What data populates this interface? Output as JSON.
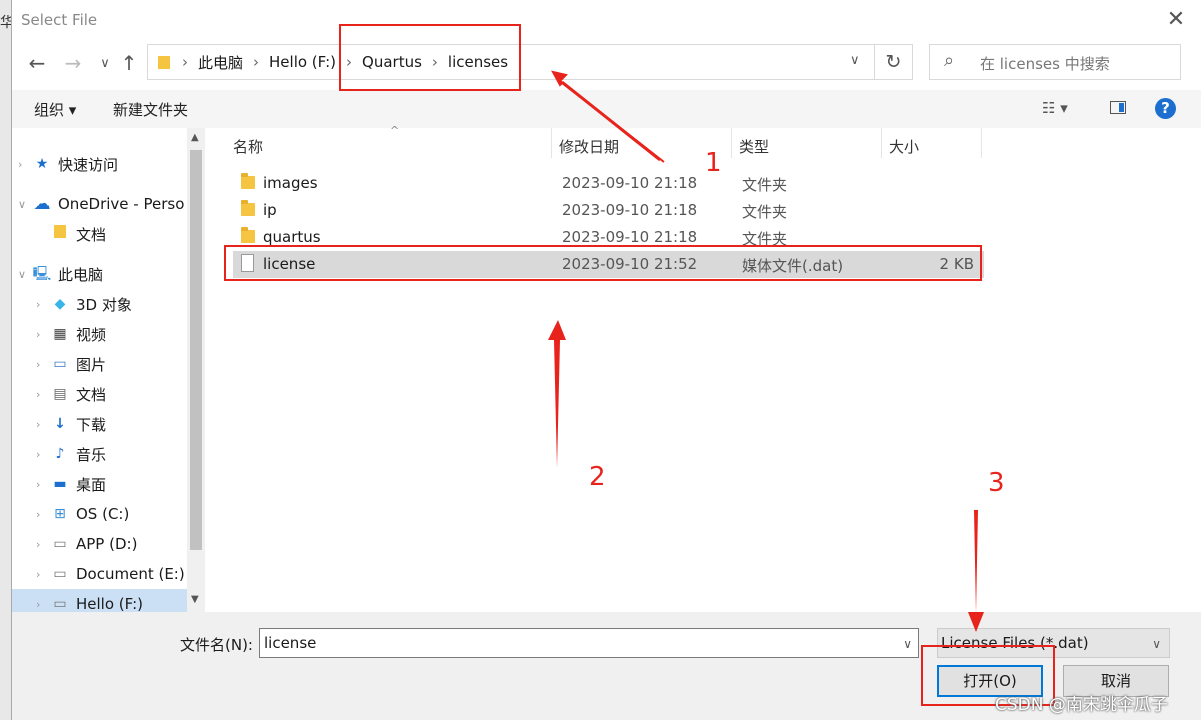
{
  "title": "Select File",
  "nav_buttons": {
    "back": "←",
    "forward": "→",
    "recent": "∨",
    "up": "↑"
  },
  "breadcrumbs": [
    "此电脑",
    "Hello (F:)",
    "Quartus",
    "licenses"
  ],
  "search_placeholder": "在 licenses 中搜索",
  "toolbar": {
    "organize": "组织 ▾",
    "new_folder": "新建文件夹"
  },
  "sidebar": [
    {
      "label": "快速访问",
      "icon": "star-icon",
      "indent": 1
    },
    {
      "label": "OneDrive - Perso",
      "icon": "cloud-icon",
      "indent": 1
    },
    {
      "label": "文档",
      "icon": "folder-icon",
      "indent": 2
    },
    {
      "label": "此电脑",
      "icon": "computer-icon",
      "indent": 1
    },
    {
      "label": "3D 对象",
      "icon": "cube-icon",
      "indent": 2
    },
    {
      "label": "视频",
      "icon": "video-icon",
      "indent": 2
    },
    {
      "label": "图片",
      "icon": "picture-icon",
      "indent": 2
    },
    {
      "label": "文档",
      "icon": "document-icon",
      "indent": 2
    },
    {
      "label": "下载",
      "icon": "download-icon",
      "indent": 2
    },
    {
      "label": "音乐",
      "icon": "music-icon",
      "indent": 2
    },
    {
      "label": "桌面",
      "icon": "desktop-icon",
      "indent": 2
    },
    {
      "label": "OS (C:)",
      "icon": "drive-icon",
      "indent": 2
    },
    {
      "label": "APP (D:)",
      "icon": "drive-icon",
      "indent": 2
    },
    {
      "label": "Document (E:)",
      "icon": "drive-icon",
      "indent": 2
    },
    {
      "label": "Hello (F:)",
      "icon": "drive-icon",
      "indent": 2,
      "selected": true
    }
  ],
  "columns": {
    "name": "名称",
    "date": "修改日期",
    "type": "类型",
    "size": "大小"
  },
  "files": [
    {
      "name": "images",
      "date": "2023-09-10 21:18",
      "type": "文件夹",
      "size": "",
      "kind": "folder"
    },
    {
      "name": "ip",
      "date": "2023-09-10 21:18",
      "type": "文件夹",
      "size": "",
      "kind": "folder"
    },
    {
      "name": "quartus",
      "date": "2023-09-10 21:18",
      "type": "文件夹",
      "size": "",
      "kind": "folder"
    },
    {
      "name": "license",
      "date": "2023-09-10 21:52",
      "type": "媒体文件(.dat)",
      "size": "2 KB",
      "kind": "file",
      "selected": true
    }
  ],
  "filename_label": "文件名(N):",
  "filename_value": "license",
  "filter_value": "License Files (*.dat)",
  "open_button": "打开(O)",
  "cancel_button": "取消",
  "annotations": [
    "1",
    "2",
    "3"
  ],
  "watermark": "CSDN @南宋跳伞瓜子",
  "accent": "#e8231c"
}
